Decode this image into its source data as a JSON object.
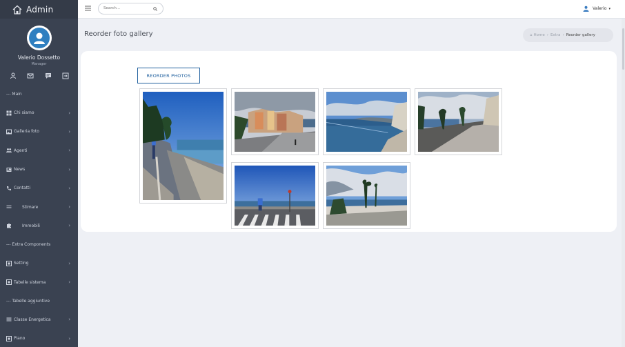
{
  "brand": {
    "title": "Admin"
  },
  "profile": {
    "name": "Valerio Dossetto",
    "role": "Manager"
  },
  "sidebar": {
    "items": [
      {
        "type": "section",
        "label": "--- Main"
      },
      {
        "type": "item",
        "label": "Chi siamo",
        "icon": "grid-icon"
      },
      {
        "type": "item",
        "label": "Galleria foto",
        "icon": "image-icon"
      },
      {
        "type": "item",
        "label": "Agenti",
        "icon": "users-icon"
      },
      {
        "type": "item",
        "label": "News",
        "icon": "newspaper-icon"
      },
      {
        "type": "item",
        "label": "Contatti",
        "icon": "phone-icon"
      },
      {
        "type": "item",
        "label": "Stimare",
        "icon": "bars-icon",
        "indent": true
      },
      {
        "type": "item",
        "label": "Immobili",
        "icon": "puzzle-icon",
        "indent": true
      },
      {
        "type": "section",
        "label": "--- Extra Components"
      },
      {
        "type": "item",
        "label": "Setting",
        "icon": "box-icon"
      },
      {
        "type": "item",
        "label": "Tabelle sistema",
        "icon": "box-icon"
      },
      {
        "type": "section",
        "label": "--- Tabelle aggiuntive"
      },
      {
        "type": "item",
        "label": "Classe Energetica",
        "icon": "bars-icon"
      },
      {
        "type": "item",
        "label": "Piano",
        "icon": "box-icon"
      }
    ]
  },
  "search": {
    "placeholder": "Search..."
  },
  "user": {
    "name": "Valerio"
  },
  "page": {
    "title": "Reorder foto gallery"
  },
  "breadcrumb": {
    "home": "Home",
    "extra": "Extra",
    "current": "Reorder gallery"
  },
  "actions": {
    "reorder_label": "REORDER PHOTOS"
  },
  "photos": [
    {
      "name": "promenade-vertical"
    },
    {
      "name": "menton-old-town"
    },
    {
      "name": "coastline-bay"
    },
    {
      "name": "seaside-walk-palms"
    },
    {
      "name": "road-crosswalk"
    },
    {
      "name": "beach-palms"
    }
  ]
}
